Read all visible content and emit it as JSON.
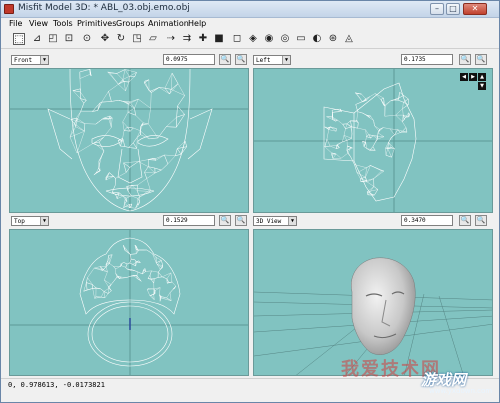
{
  "window": {
    "title": "Misfit Model 3D: * ABL_03.obj.emo.obj",
    "minimize_label": "–",
    "maximize_label": "□",
    "close_label": "✕"
  },
  "menubar": {
    "items": [
      "File",
      "View",
      "Tools",
      "Primitives",
      "Groups",
      "Animation",
      "Help"
    ]
  },
  "toolbar": {
    "tools": [
      {
        "icon": "select-vertices-icon",
        "glyph": "⬚"
      },
      {
        "icon": "select-faces-icon",
        "glyph": "⊿"
      },
      {
        "icon": "select-connected-icon",
        "glyph": "◰"
      },
      {
        "icon": "select-bone-icon",
        "glyph": "⊡"
      },
      {
        "icon": "select-point-icon",
        "glyph": "⊙"
      },
      {
        "icon": "move-icon",
        "glyph": "✥"
      },
      {
        "icon": "rotate-icon",
        "glyph": "↻"
      },
      {
        "icon": "scale-icon",
        "glyph": "◳"
      },
      {
        "icon": "shear-icon",
        "glyph": "▱"
      },
      {
        "icon": "extrude-icon",
        "glyph": "⇢"
      },
      {
        "icon": "attract-icon",
        "glyph": "⇉"
      },
      {
        "icon": "drag-vertex-icon",
        "glyph": "✚"
      },
      {
        "icon": "background-icon",
        "glyph": "■"
      },
      {
        "icon": "create-vertex-icon",
        "glyph": "◻"
      },
      {
        "icon": "create-cube-icon",
        "glyph": "◈"
      },
      {
        "icon": "create-ellipse-icon",
        "glyph": "◉"
      },
      {
        "icon": "create-cylinder-icon",
        "glyph": "◎"
      },
      {
        "icon": "create-torus-icon",
        "glyph": "▭"
      },
      {
        "icon": "create-polygon-icon",
        "glyph": "◐"
      },
      {
        "icon": "create-bone-icon",
        "glyph": "⊛"
      },
      {
        "icon": "create-projection-icon",
        "glyph": "◬"
      }
    ]
  },
  "views": {
    "top_left": {
      "view": "Front",
      "zoom": "0.0975",
      "zoom_in": "🔍",
      "zoom_out": "🔍"
    },
    "top_right": {
      "view": "Left",
      "zoom": "0.1735",
      "zoom_in": "🔍",
      "zoom_out": "🔍"
    },
    "bottom_left": {
      "view": "Top",
      "zoom": "0.1529",
      "zoom_in": "🔍",
      "zoom_out": "🔍"
    },
    "bottom_right": {
      "view": "3D View",
      "zoom": "0.3470",
      "zoom_in": "🔍",
      "zoom_out": "🔍"
    }
  },
  "nav_arrows": {
    "left": "◀",
    "right": "▶",
    "up": "▲",
    "down": "▼"
  },
  "status": {
    "text": "0, 0.978613, -0.0173821"
  },
  "watermark": {
    "text1": "我爱技术网",
    "text2": "游戏网",
    "url": "www.yxdown.com"
  },
  "colors": {
    "viewport_bg": "#81c3c1",
    "wire": "#ffffff"
  }
}
